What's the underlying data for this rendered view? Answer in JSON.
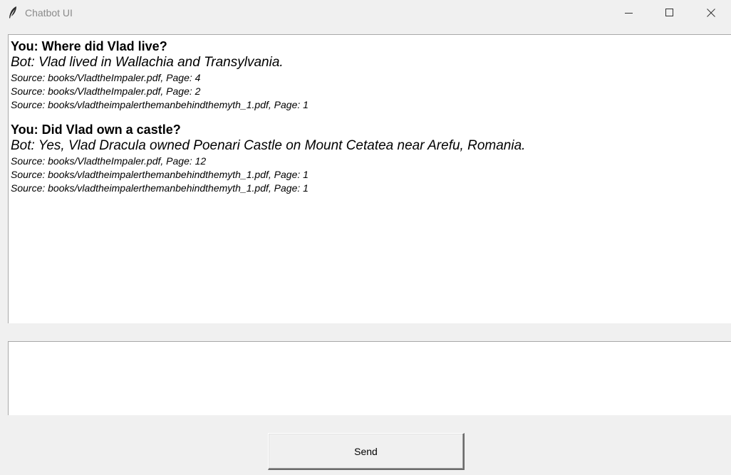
{
  "window": {
    "title": "Chatbot UI",
    "icon": "feather-icon"
  },
  "controls": {
    "minimize": "minimize-icon",
    "maximize": "maximize-icon",
    "close": "close-icon"
  },
  "chat": {
    "messages": [
      {
        "user": "You: Where did Vlad live?",
        "bot": "Bot: Vlad lived in Wallachia and Transylvania.",
        "sources": [
          "Source: books/VladtheImpaler.pdf, Page: 4",
          "Source: books/VladtheImpaler.pdf, Page: 2",
          "Source: books/vladtheimpalerthemanbehindthemyth_1.pdf, Page: 1"
        ]
      },
      {
        "user": "You: Did Vlad own a castle?",
        "bot": "Bot: Yes, Vlad Dracula owned Poenari Castle on Mount Cetatea near Arefu, Romania.",
        "sources": [
          "Source: books/VladtheImpaler.pdf, Page: 12",
          "Source: books/vladtheimpalerthemanbehindthemyth_1.pdf, Page: 1",
          "Source: books/vladtheimpalerthemanbehindthemyth_1.pdf, Page: 1"
        ]
      }
    ]
  },
  "input": {
    "value": ""
  },
  "send_button": {
    "label": "Send"
  }
}
